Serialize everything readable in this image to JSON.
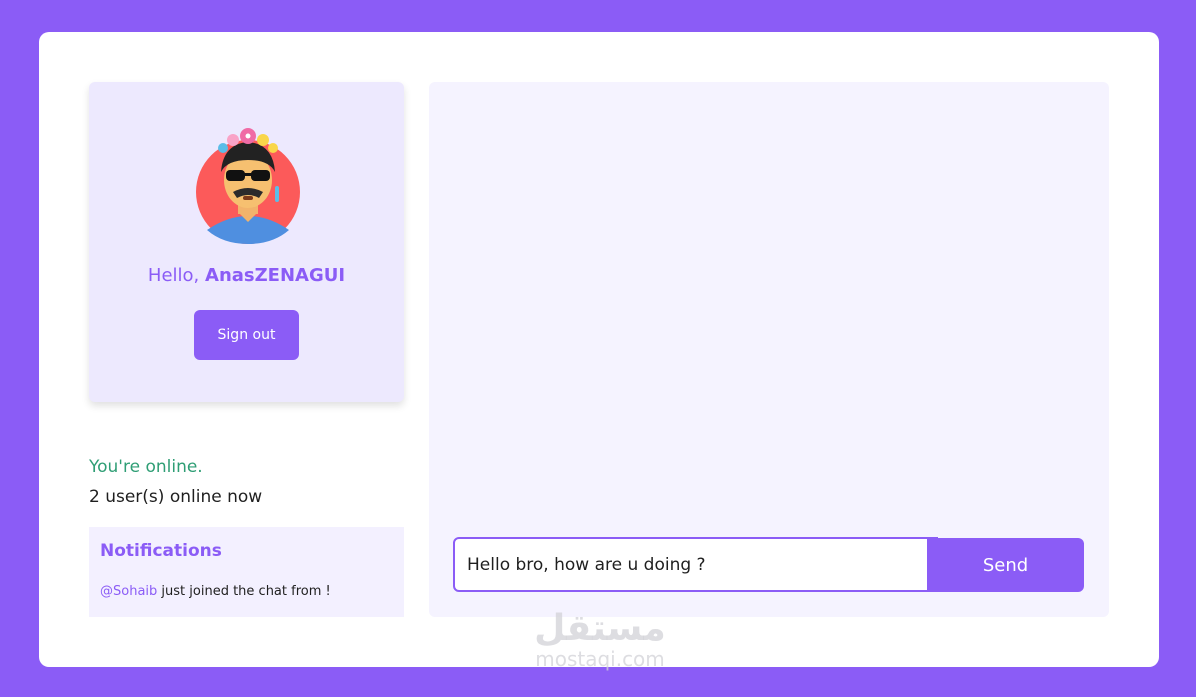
{
  "colors": {
    "accent": "#8b5cf6",
    "background": "#8b5cf6",
    "card": "#ffffff",
    "profile_panel": "#ede9fe",
    "chat_panel": "#f5f3ff",
    "online_green": "#2f9e75"
  },
  "profile": {
    "avatar_icon": "avatar-icon",
    "greeting": "Hello,",
    "username": "AnasZENAGUI",
    "signout_label": "Sign out"
  },
  "status": {
    "online_text": "You're online.",
    "users_online_text": "2 user(s) online now"
  },
  "notifications": {
    "title": "Notifications",
    "items": [
      {
        "user": "@Sohaib",
        "text": "just joined the chat from !"
      }
    ]
  },
  "chat": {
    "input_value": "Hello bro, how are u doing ?",
    "send_label": "Send"
  },
  "watermark": {
    "arabic": "مستقل",
    "latin": "mostaqi.com"
  }
}
